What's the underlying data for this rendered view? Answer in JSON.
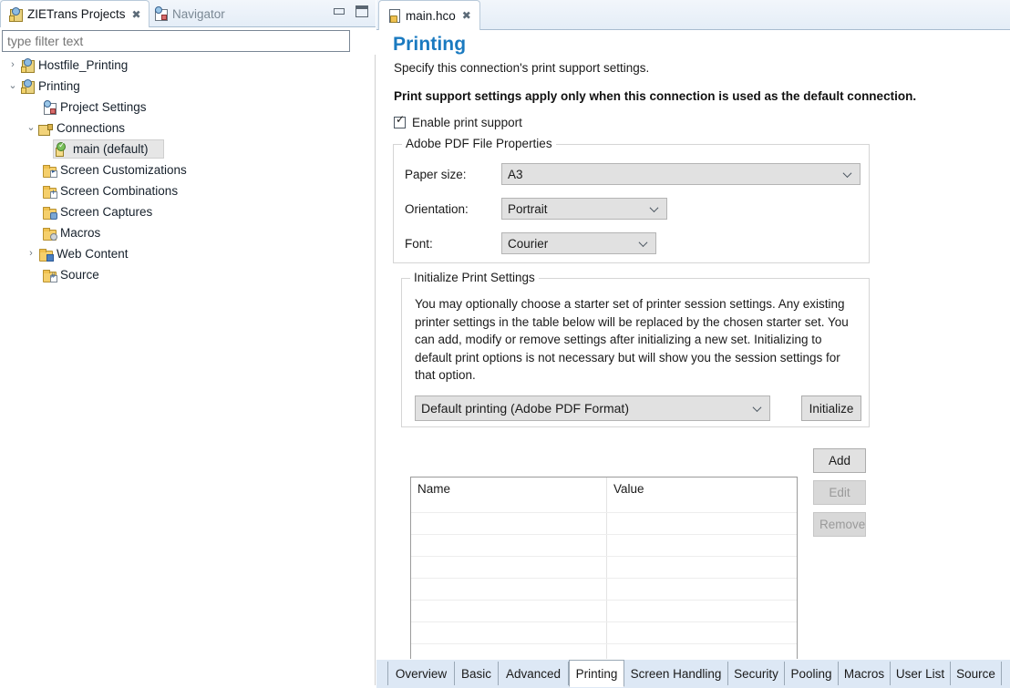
{
  "left_panel": {
    "tabs": [
      {
        "label": "ZIETrans Projects",
        "icon": "projects-icon",
        "active": true,
        "close": "✖"
      },
      {
        "label": "Navigator",
        "icon": "navigator-icon",
        "active": false
      }
    ],
    "window_controls": {
      "minimize": "minimize-icon",
      "maximize": "maximize-icon"
    },
    "filter": {
      "placeholder": "type filter text",
      "value": ""
    },
    "tree": [
      {
        "label": "Hostfile_Printing",
        "indent": 0,
        "twisty": "›",
        "icon": "project-icon",
        "selected": false
      },
      {
        "label": "Printing",
        "indent": 0,
        "twisty": "⌄",
        "icon": "project-icon",
        "selected": false
      },
      {
        "label": "Project Settings",
        "indent": 1,
        "twisty": "",
        "icon": "project-settings-icon",
        "selected": false
      },
      {
        "label": "Connections",
        "indent": 1,
        "twisty": "⌄",
        "icon": "connections-icon",
        "selected": false
      },
      {
        "label": "main (default)",
        "indent": 2,
        "twisty": "",
        "icon": "connection-default-icon",
        "selected": true
      },
      {
        "label": "Screen Customizations",
        "indent": 1,
        "twisty": "",
        "icon": "folder-customizations-icon",
        "selected": false
      },
      {
        "label": "Screen Combinations",
        "indent": 1,
        "twisty": "",
        "icon": "folder-combinations-icon",
        "selected": false
      },
      {
        "label": "Screen Captures",
        "indent": 1,
        "twisty": "",
        "icon": "folder-captures-icon",
        "selected": false
      },
      {
        "label": "Macros",
        "indent": 1,
        "twisty": "",
        "icon": "folder-macros-icon",
        "selected": false
      },
      {
        "label": "Web Content",
        "indent": 1,
        "twisty": "›",
        "icon": "folder-webcontent-icon",
        "selected": false
      },
      {
        "label": "Source",
        "indent": 1,
        "twisty": "",
        "icon": "folder-source-icon",
        "selected": false
      }
    ]
  },
  "editor": {
    "tab": {
      "label": "main.hco",
      "icon": "hco-file-icon",
      "close": "✖"
    },
    "title": "Printing",
    "subtitle": "Specify this connection's print support settings.",
    "note": "Print support settings apply only when this connection is used as the default connection.",
    "enable_checkbox": {
      "label": "Enable print support",
      "checked": true
    },
    "pdf_group": {
      "title": "Adobe PDF File Properties",
      "fields": [
        {
          "label": "Paper size:",
          "value": "A3"
        },
        {
          "label": "Orientation:",
          "value": "Portrait"
        },
        {
          "label": "Font:",
          "value": "Courier"
        }
      ]
    },
    "init_group": {
      "title": "Initialize Print Settings",
      "description": "You may optionally choose a starter set of printer session settings. Any existing printer settings in the table below will be replaced by the chosen starter set. You can add, modify or remove settings after initializing a new set. Initializing to default print options is not necessary but will show you the session settings for that option.",
      "select_value": "Default printing (Adobe PDF Format)",
      "initialize_button": "Initialize"
    },
    "table": {
      "columns": [
        "Name",
        "Value"
      ],
      "rows": [],
      "empty_row_count": 7
    },
    "table_buttons": [
      {
        "label": "Add",
        "enabled": true
      },
      {
        "label": "Edit",
        "enabled": false
      },
      {
        "label": "Remove",
        "enabled": false
      }
    ],
    "bottom_tabs": [
      {
        "label": "Overview",
        "active": false
      },
      {
        "label": "Basic",
        "active": false
      },
      {
        "label": "Advanced",
        "active": false
      },
      {
        "label": "Printing",
        "active": true
      },
      {
        "label": "Screen Handling",
        "active": false
      },
      {
        "label": "Security",
        "active": false
      },
      {
        "label": "Pooling",
        "active": false
      },
      {
        "label": "Macros",
        "active": false
      },
      {
        "label": "User List",
        "active": false
      },
      {
        "label": "Source",
        "active": false
      }
    ]
  },
  "colors": {
    "title_blue": "#1a7ac0",
    "tab_bar": "#e4edf7",
    "selection": "#e6e6e6",
    "bottom_tab_bg": "#dde8f5"
  }
}
